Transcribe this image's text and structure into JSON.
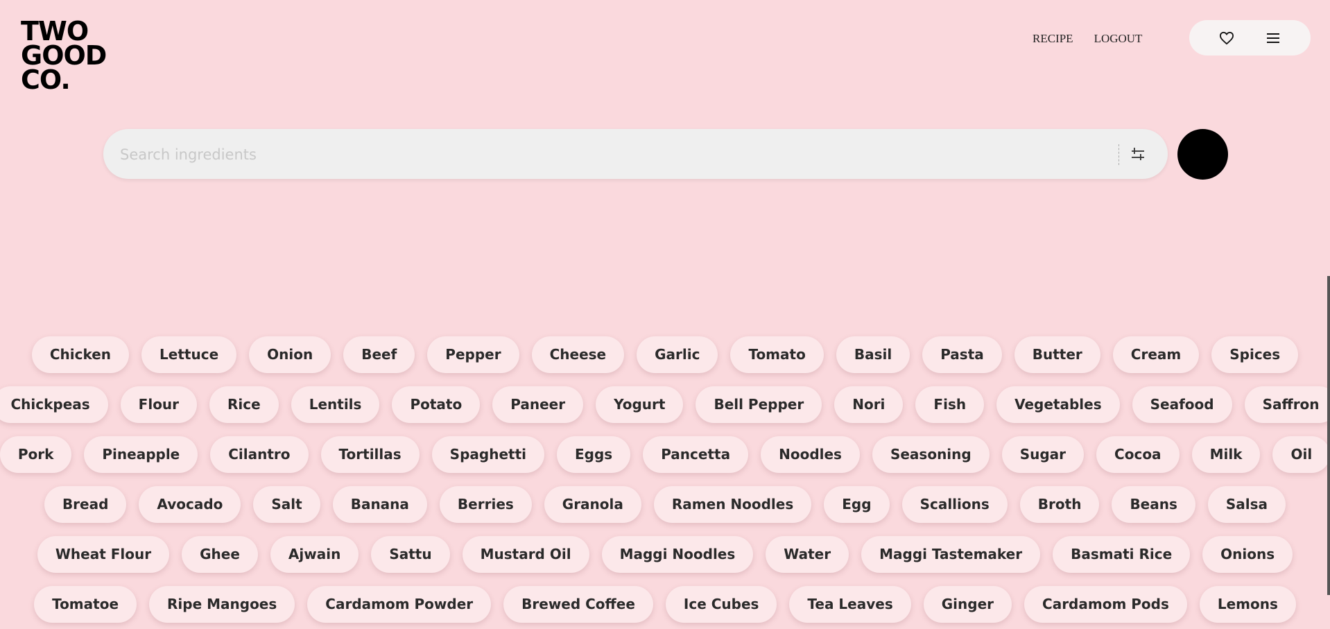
{
  "logo": {
    "lines": [
      "TWO",
      "GOOD",
      "CO."
    ]
  },
  "nav": {
    "recipe": "RECIPE",
    "logout": "LOGOUT"
  },
  "icons": {
    "favorites": "heart-icon",
    "menu": "hamburger-menu-icon",
    "filter": "sliders-icon"
  },
  "search": {
    "placeholder": "Search ingredients",
    "value": ""
  },
  "colors": {
    "background": "#fad9dd",
    "tag_background": "#fce8ea",
    "search_background": "#efefef",
    "button": "#000000"
  },
  "ingredients": {
    "rows": [
      [
        "Chicken",
        "Lettuce",
        "Onion",
        "Beef",
        "Pepper",
        "Cheese",
        "Garlic",
        "Tomato",
        "Basil",
        "Pasta",
        "Butter",
        "Cream",
        "Spices"
      ],
      [
        "Chickpeas",
        "Flour",
        "Rice",
        "Lentils",
        "Potato",
        "Paneer",
        "Yogurt",
        "Bell Pepper",
        "Nori",
        "Fish",
        "Vegetables",
        "Seafood",
        "Saffron"
      ],
      [
        "Pork",
        "Pineapple",
        "Cilantro",
        "Tortillas",
        "Spaghetti",
        "Eggs",
        "Pancetta",
        "Noodles",
        "Seasoning",
        "Sugar",
        "Cocoa",
        "Milk",
        "Oil"
      ],
      [
        "Bread",
        "Avocado",
        "Salt",
        "Banana",
        "Berries",
        "Granola",
        "Ramen Noodles",
        "Egg",
        "Scallions",
        "Broth",
        "Beans",
        "Salsa"
      ],
      [
        "Wheat Flour",
        "Ghee",
        "Ajwain",
        "Sattu",
        "Mustard Oil",
        "Maggi Noodles",
        "Water",
        "Maggi Tastemaker",
        "Basmati Rice",
        "Onions"
      ],
      [
        "Tomatoe",
        "Ripe Mangoes",
        "Cardamom Powder",
        "Brewed Coffee",
        "Ice Cubes",
        "Tea Leaves",
        "Ginger",
        "Cardamom Pods",
        "Lemons"
      ]
    ]
  }
}
